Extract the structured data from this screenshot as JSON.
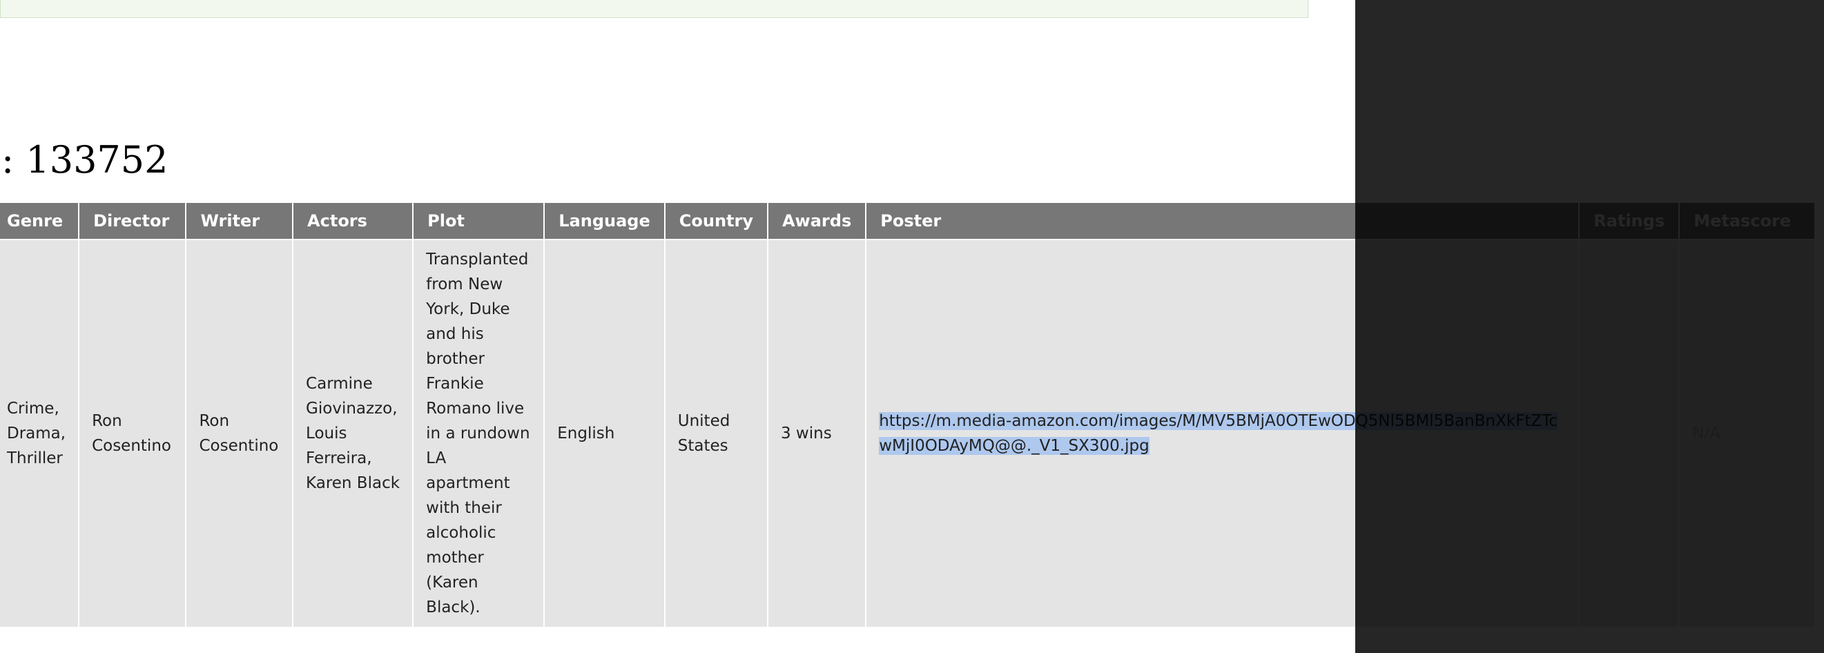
{
  "heading": ": 133752",
  "table": {
    "headers": [
      "Genre",
      "Director",
      "Writer",
      "Actors",
      "Plot",
      "Language",
      "Country",
      "Awards",
      "Poster",
      "Ratings",
      "Metascore"
    ],
    "row": {
      "genre": "Crime, Drama, Thriller",
      "director": "Ron Cosentino",
      "writer": "Ron Cosentino",
      "actors": "Carmine Giovinazzo, Louis Ferreira, Karen Black",
      "plot": "Transplanted from New York, Duke and his brother Frankie Romano live in a rundown LA apartment with their alcoholic mother (Karen Black).",
      "language": "English",
      "country": "United States",
      "awards": "3 wins",
      "poster": "https://m.media-amazon.com/images/M/MV5BMjA0OTEwODQ5Nl5BMl5BanBnXkFtZTcwMjI0ODAyMQ@@._V1_SX300.jpg",
      "ratings": "",
      "metascore": "N/A"
    }
  },
  "colors": {
    "header_bg": "#777777",
    "cell_bg": "#e4e4e4",
    "selection": "#aec8ee",
    "overlay": "#262626"
  }
}
